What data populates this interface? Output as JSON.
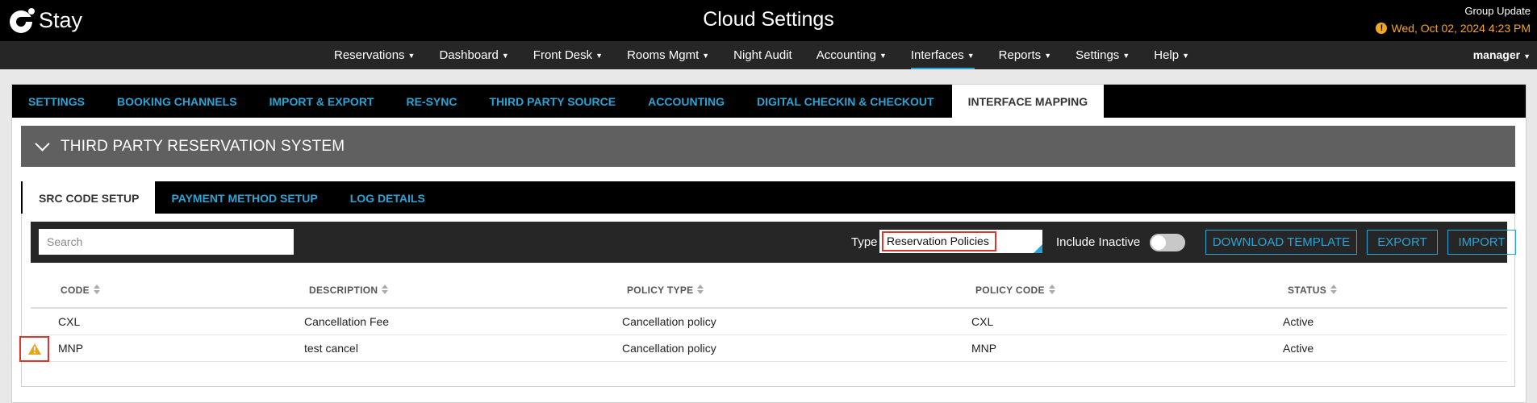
{
  "header": {
    "brand": "Stay",
    "title": "Cloud Settings",
    "group_update": "Group Update",
    "datetime": "Wed, Oct 02, 2024 4:23 PM",
    "alert_glyph": "!"
  },
  "nav": {
    "items": [
      {
        "label": "Reservations",
        "caret": "▼"
      },
      {
        "label": "Dashboard",
        "caret": "▼"
      },
      {
        "label": "Front Desk",
        "caret": "▼"
      },
      {
        "label": "Rooms Mgmt",
        "caret": "▼"
      },
      {
        "label": "Night Audit",
        "caret": ""
      },
      {
        "label": "Accounting",
        "caret": "▼"
      },
      {
        "label": "Interfaces",
        "caret": "▼"
      },
      {
        "label": "Reports",
        "caret": "▼"
      },
      {
        "label": "Settings",
        "caret": "▼"
      },
      {
        "label": "Help",
        "caret": "▼"
      }
    ],
    "active": "Interfaces",
    "user": "manager",
    "user_caret": "▼"
  },
  "tabs": [
    "SETTINGS",
    "BOOKING CHANNELS",
    "IMPORT & EXPORT",
    "RE-SYNC",
    "THIRD PARTY SOURCE",
    "ACCOUNTING",
    "DIGITAL CHECKIN & CHECKOUT",
    "INTERFACE MAPPING"
  ],
  "active_tab": "INTERFACE MAPPING",
  "section": {
    "title": "THIRD PARTY RESERVATION SYSTEM",
    "expanded": true
  },
  "subtabs": [
    "SRC CODE SETUP",
    "PAYMENT METHOD SETUP",
    "LOG DETAILS"
  ],
  "active_subtab": "SRC CODE SETUP",
  "toolbar": {
    "search_placeholder": "Search",
    "search_value": "",
    "type_label": "Type",
    "type_value": "Reservation Policies",
    "include_inactive_label": "Include Inactive",
    "include_inactive_on": false,
    "download_template": "DOWNLOAD TEMPLATE",
    "export": "EXPORT",
    "import": "IMPORT"
  },
  "table": {
    "columns": [
      "CODE",
      "DESCRIPTION",
      "POLICY TYPE",
      "POLICY CODE",
      "STATUS"
    ],
    "rows": [
      {
        "code": "CXL",
        "description": "Cancellation Fee",
        "policy_type": "Cancellation policy",
        "policy_code": "CXL",
        "status": "Active",
        "warning": false
      },
      {
        "code": "MNP",
        "description": "test cancel",
        "policy_type": "Cancellation policy",
        "policy_code": "MNP",
        "status": "Active",
        "warning": true
      }
    ]
  },
  "colors": {
    "accent": "#2aa4d4",
    "alert": "#f5a623",
    "highlight_border": "#d9382e",
    "warning_icon": "#e8a317"
  }
}
